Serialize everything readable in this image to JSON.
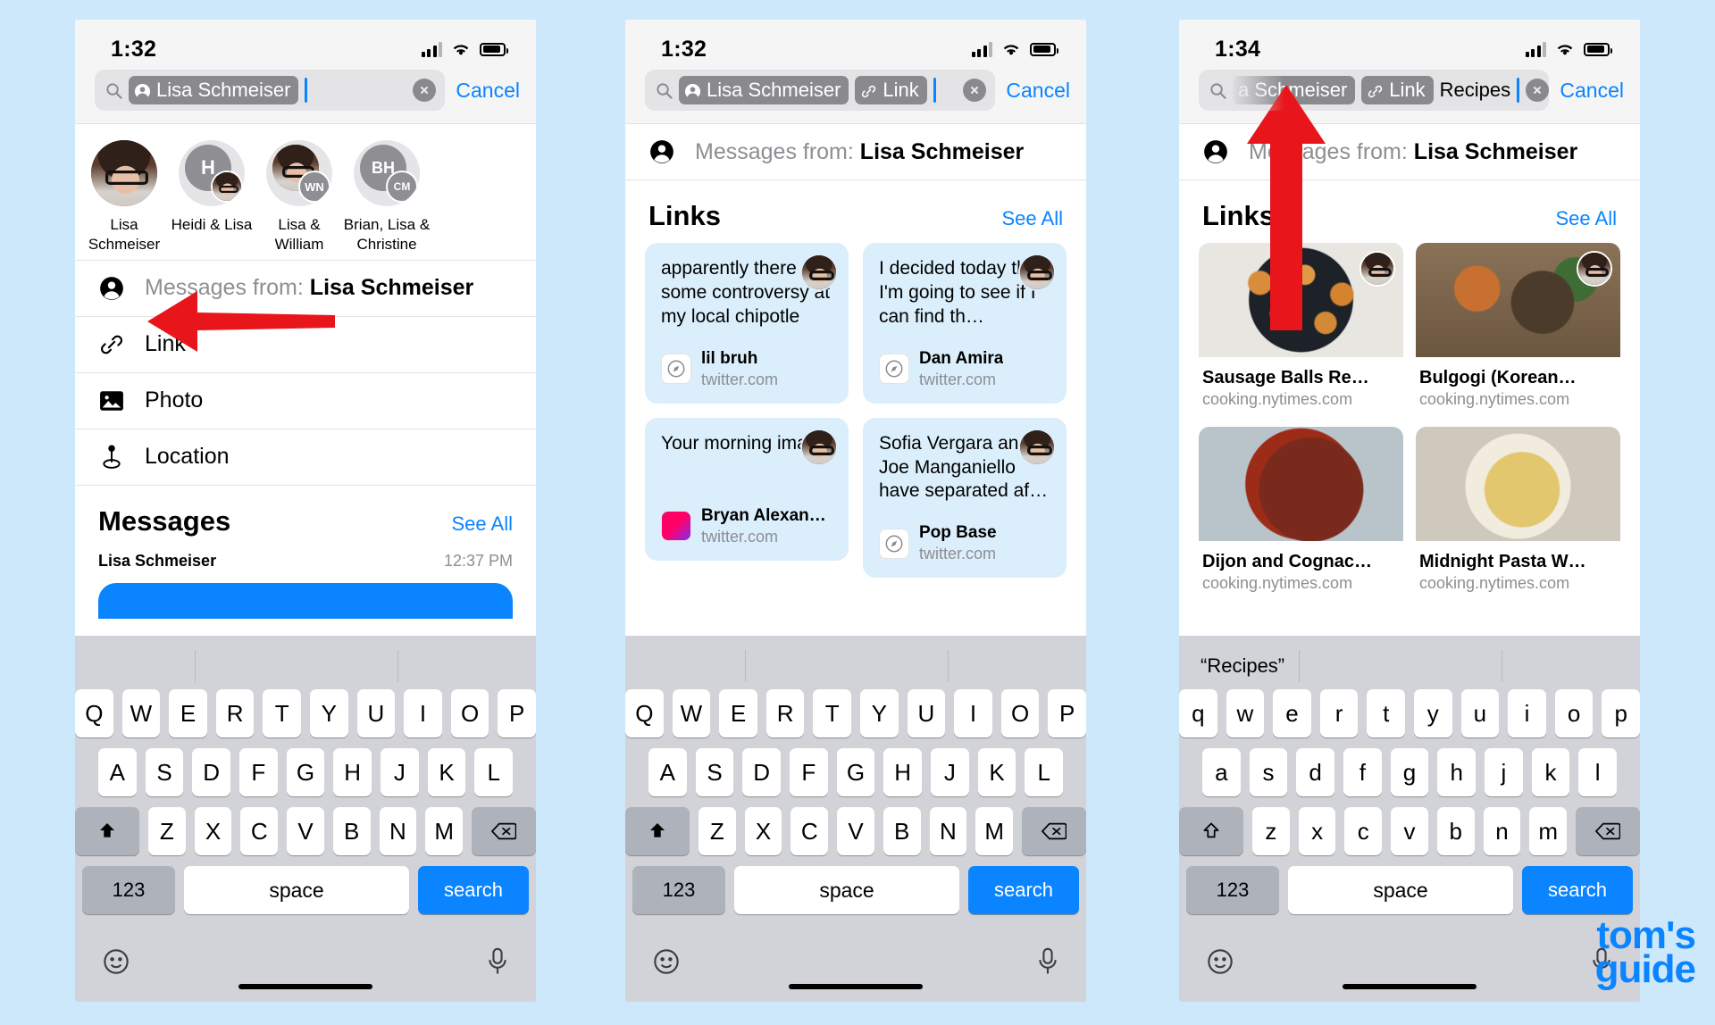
{
  "page": {
    "background_color": "#cde8fa",
    "accent_color": "#0a84ff",
    "arrow_color": "#e8151a"
  },
  "watermark": {
    "line1": "tom's",
    "line2": "guide"
  },
  "phones": [
    {
      "id": "phone-1",
      "status": {
        "time": "1:32"
      },
      "search": {
        "tokens": [
          {
            "icon": "person-circle-icon",
            "label": "Lisa Schmeiser"
          }
        ],
        "typed": "",
        "caret": true,
        "clear_label": "clear",
        "cancel_label": "Cancel"
      },
      "contacts": [
        {
          "name": "Lisa Schmeiser",
          "kind": "photo"
        },
        {
          "name": "Heidi & Lisa",
          "kind": "initial-plus-photo",
          "initials": "H"
        },
        {
          "name": "Lisa & William",
          "kind": "photo-plus-initial",
          "initials": "WN"
        },
        {
          "name": "Brian, Lisa & Christine",
          "kind": "initials-stack",
          "initials": "BH",
          "initials2": "CM"
        }
      ],
      "filter_row": {
        "icon": "person-circle-icon",
        "prefix": "Messages from:",
        "value": "Lisa Schmeiser"
      },
      "options": [
        {
          "icon": "link-icon",
          "label": "Link"
        },
        {
          "icon": "photo-icon",
          "label": "Photo"
        },
        {
          "icon": "location-pin-icon",
          "label": "Location"
        }
      ],
      "messages_section": {
        "title": "Messages",
        "see_all": "See All",
        "sender": "Lisa Schmeiser",
        "time": "12:37 PM"
      },
      "keyboard": {
        "case": "upper",
        "row1": [
          "Q",
          "W",
          "E",
          "R",
          "T",
          "Y",
          "U",
          "I",
          "O",
          "P"
        ],
        "row2": [
          "A",
          "S",
          "D",
          "F",
          "G",
          "H",
          "J",
          "K",
          "L"
        ],
        "row3": [
          "Z",
          "X",
          "C",
          "V",
          "B",
          "N",
          "M"
        ],
        "shift_icon": "shift-filled-icon",
        "backspace_icon": "backspace-icon",
        "numeric_label": "123",
        "space_label": "space",
        "search_label": "search",
        "emoji_icon": "emoji-icon",
        "mic_icon": "microphone-icon",
        "suggestion": ""
      }
    },
    {
      "id": "phone-2",
      "status": {
        "time": "1:32"
      },
      "search": {
        "tokens": [
          {
            "icon": "person-circle-icon",
            "label": "Lisa Schmeiser"
          },
          {
            "icon": "link-icon",
            "label": "Link"
          }
        ],
        "typed": "",
        "caret": true,
        "clear_label": "clear",
        "cancel_label": "Cancel"
      },
      "filter_row": {
        "icon": "person-circle-icon",
        "prefix": "Messages from:",
        "value": "Lisa Schmeiser"
      },
      "links_section": {
        "title": "Links",
        "see_all": "See All",
        "cards": [
          {
            "text": "apparently there some controversy at my local chipotle",
            "source": "lil bruh",
            "domain": "twitter.com",
            "favicon": "compass-icon",
            "avatar": "man-photo"
          },
          {
            "text": "I decided today that I'm going to see if I can find th…",
            "source": "Dan Amira",
            "domain": "twitter.com",
            "favicon": "compass-icon",
            "avatar": "woman-photo"
          },
          {
            "text": "Your morning image:",
            "source": "Bryan Alexan…",
            "domain": "twitter.com",
            "favicon": "gradient-icon",
            "avatar": "woman-photo"
          },
          {
            "text": "Sofia Vergara an Joe Manganiello have separated af…",
            "source": "Pop Base",
            "domain": "twitter.com",
            "favicon": "compass-icon",
            "avatar": "man-photo"
          }
        ]
      },
      "keyboard": {
        "case": "upper",
        "row1": [
          "Q",
          "W",
          "E",
          "R",
          "T",
          "Y",
          "U",
          "I",
          "O",
          "P"
        ],
        "row2": [
          "A",
          "S",
          "D",
          "F",
          "G",
          "H",
          "J",
          "K",
          "L"
        ],
        "row3": [
          "Z",
          "X",
          "C",
          "V",
          "B",
          "N",
          "M"
        ],
        "shift_icon": "shift-filled-icon",
        "backspace_icon": "backspace-icon",
        "numeric_label": "123",
        "space_label": "space",
        "search_label": "search",
        "emoji_icon": "emoji-icon",
        "mic_icon": "microphone-icon",
        "suggestion": ""
      }
    },
    {
      "id": "phone-3",
      "status": {
        "time": "1:34"
      },
      "search": {
        "tokens": [
          {
            "icon": "person-circle-icon",
            "label": "a Schmeiser"
          },
          {
            "icon": "link-icon",
            "label": "Link"
          }
        ],
        "typed": "Recipes",
        "caret": true,
        "clear_label": "clear",
        "cancel_label": "Cancel"
      },
      "filter_row": {
        "icon": "person-circle-icon",
        "prefix": "Messages from:",
        "value": "Lisa Schmeiser"
      },
      "links_section": {
        "title": "Links",
        "see_all": "See All",
        "cards": [
          {
            "title": "Sausage Balls Re…",
            "domain": "cooking.nytimes.com",
            "thumb": "sausage-balls"
          },
          {
            "title": "Bulgogi (Korean…",
            "domain": "cooking.nytimes.com",
            "thumb": "bulgogi"
          },
          {
            "title": "Dijon and Cognac…",
            "domain": "cooking.nytimes.com",
            "thumb": "beef-stew"
          },
          {
            "title": "Midnight Pasta W…",
            "domain": "cooking.nytimes.com",
            "thumb": "pasta"
          }
        ]
      },
      "keyboard": {
        "case": "lower",
        "row1": [
          "q",
          "w",
          "e",
          "r",
          "t",
          "y",
          "u",
          "i",
          "o",
          "p"
        ],
        "row2": [
          "a",
          "s",
          "d",
          "f",
          "g",
          "h",
          "j",
          "k",
          "l"
        ],
        "row3": [
          "z",
          "x",
          "c",
          "v",
          "b",
          "n",
          "m"
        ],
        "shift_icon": "shift-outline-icon",
        "backspace_icon": "backspace-icon",
        "numeric_label": "123",
        "space_label": "space",
        "search_label": "search",
        "emoji_icon": "emoji-icon",
        "mic_icon": "microphone-icon",
        "suggestion": "“Recipes”"
      }
    }
  ]
}
